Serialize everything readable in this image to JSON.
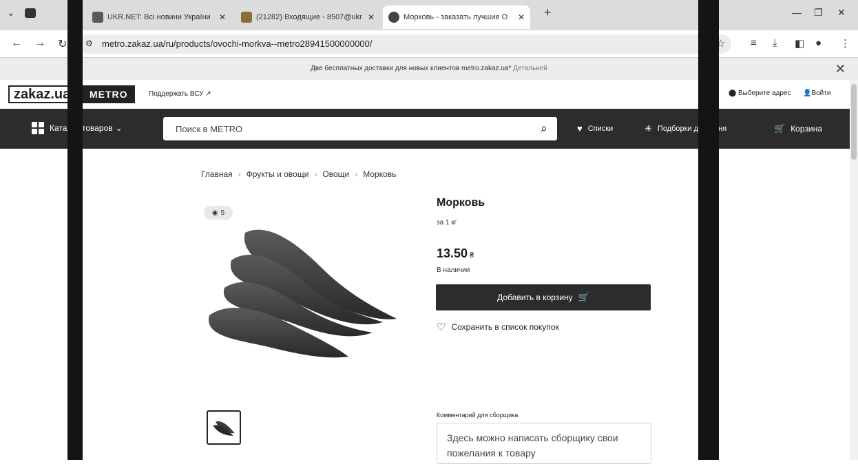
{
  "browser": {
    "tabs": [
      {
        "title": "UKR.NET: Всі новини України",
        "active": false,
        "favicon_color": "#5a5a5a"
      },
      {
        "title": "(21282) Входящие - 8507@ukr",
        "active": false,
        "favicon_color": "#8a6d3b"
      },
      {
        "title": "Морковь - заказать лучшие О",
        "active": true,
        "favicon_color": "#444444"
      }
    ],
    "new_tab_label": "+",
    "address": "metro.zakaz.ua/ru/products/ovochi-morkva--metro28941500000000/"
  },
  "promo": {
    "text": "Две бесплатных доставки для новых клиентов metro.zakaz.ua*",
    "link": "Детальней",
    "close": "✕"
  },
  "header": {
    "logo_zakaz": "zakaz.ua",
    "logo_metro": "METRO",
    "support_link": "Поддержать ВСУ ↗",
    "address_btn": "Выберите адрес",
    "login_btn": "Войти"
  },
  "nav": {
    "catalog": "Каталог товаров",
    "search_placeholder": "Поиск в METRO",
    "lists": "Списки",
    "picks": "Подборки для меня",
    "cart": "Корзина"
  },
  "breadcrumb": [
    "Главная",
    "Фрукты и овощи",
    "Овощи",
    "Морковь"
  ],
  "product": {
    "views": "5",
    "title": "Морковь",
    "unit": "за 1 кг",
    "price": "13.50",
    "currency": "₴",
    "stock": "В наличии",
    "add_to_cart": "Добавить в корзину",
    "save_to_list": "Сохранить в список покупок",
    "comment_label": "Комментарий для сборщика",
    "comment_placeholder": "Здесь можно написать сборщику свои пожелания к товару"
  },
  "colors": {
    "nav_bg": "#2c2c2c",
    "button_bg": "#2c2c2c"
  }
}
